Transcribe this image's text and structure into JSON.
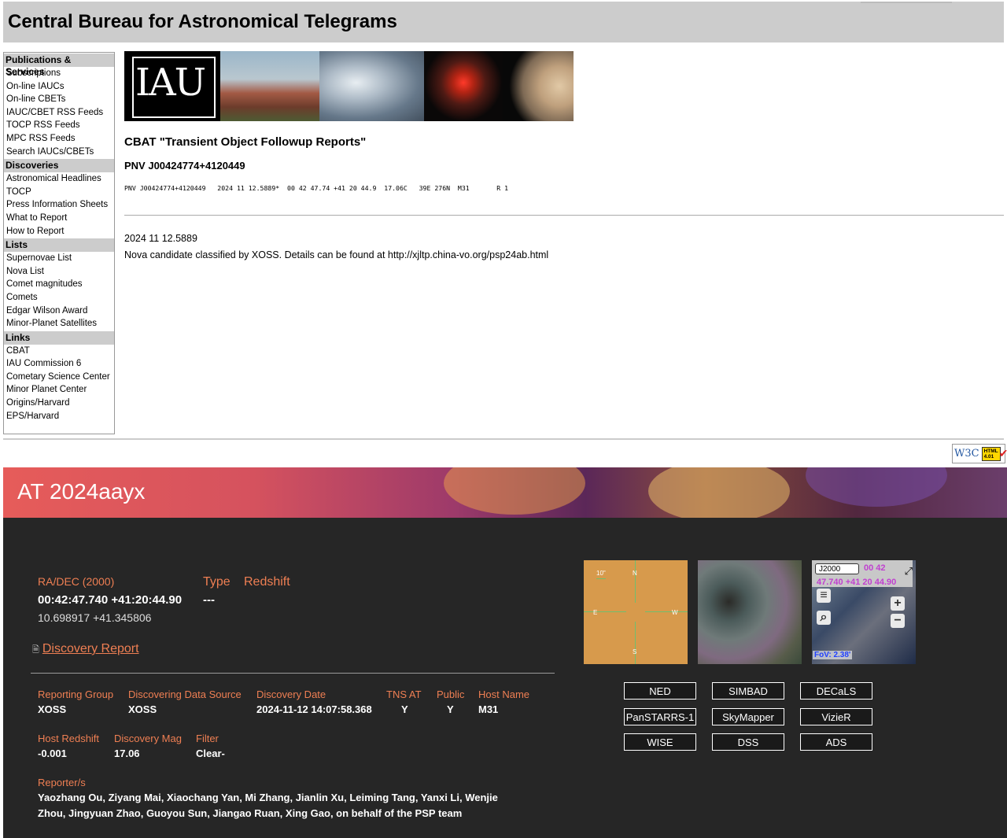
{
  "cbat": {
    "title": "Central Bureau for Astronomical Telegrams",
    "sidebar": [
      {
        "heading": "Publications & Services",
        "items": [
          "Subscriptions",
          "On-line IAUCs",
          "On-line CBETs",
          "IAUC/CBET RSS Feeds",
          "TOCP RSS Feeds",
          "MPC RSS Feeds",
          "Search IAUCs/CBETs"
        ]
      },
      {
        "heading": "Discoveries",
        "items": [
          "Astronomical Headlines",
          "TOCP",
          "Press Information Sheets",
          "What to Report",
          "How to Report"
        ]
      },
      {
        "heading": "Lists",
        "items": [
          "Supernovae List",
          "Nova List",
          "Comet magnitudes",
          "Comets",
          "Edgar Wilson Award",
          "Minor-Planet Satellites"
        ]
      },
      {
        "heading": "Links",
        "items": [
          "CBAT",
          "IAU Commission 6",
          "Cometary Science Center",
          "Minor Planet Center",
          "Origins/Harvard",
          "EPS/Harvard"
        ]
      }
    ],
    "banner_logo": "IAU",
    "heading": "CBAT \"Transient Object Followup Reports\"",
    "object": "PNV J00424774+4120449",
    "report_line": "PNV J00424774+4120449   2024 11 12.5889*  00 42 47.74 +41 20 44.9  17.06C   39E 276N  M31       R 1",
    "date": "2024 11 12.5889",
    "note": "Nova candidate classified by XOSS. Details can be found at http://xjltp.china-vo.org/psp24ab.html",
    "w3c_badge": {
      "w3c": "W3C",
      "html": "HTML",
      "version": "4.01"
    }
  },
  "tns": {
    "title": "AT 2024aayx",
    "radec_label": "RA/DEC (2000)",
    "radec_value": "00:42:47.740 +41:20:44.90",
    "radec_deg": "10.698917 +41.345806",
    "type_label": "Type",
    "type_value": "---",
    "redshift_label": "Redshift",
    "discovery_report": "Discovery Report",
    "fields_row1": [
      {
        "label": "Reporting Group",
        "value": "XOSS"
      },
      {
        "label": "Discovering Data Source",
        "value": "XOSS"
      },
      {
        "label": "Discovery Date",
        "value": "2024-11-12 14:07:58.368"
      },
      {
        "label": "TNS AT",
        "value": "Y"
      },
      {
        "label": "Public",
        "value": "Y"
      },
      {
        "label": "Host Name",
        "value": "M31"
      }
    ],
    "fields_row2": [
      {
        "label": "Host Redshift",
        "value": "-0.001"
      },
      {
        "label": "Discovery Mag",
        "value": "17.06"
      },
      {
        "label": "Filter",
        "value": "Clear-"
      }
    ],
    "reporters_label": "Reporter/s",
    "reporters": "Yaozhang Ou, Ziyang Mai, Xiaochang Yan, Mi Zhang, Jianlin Xu, Leiming Tang, Yanxi Li, Wenjie Zhou, Jingyuan Zhao, Guoyou Sun, Jiangao Ruan, Xing Gao, on behalf of the PSP team",
    "finder": {
      "scale": "10\"",
      "n": "N",
      "e": "E",
      "w": "W",
      "s": "S"
    },
    "aladin": {
      "frame": "J2000",
      "coord_a": "00 42",
      "coord_b": "47.740 +41 20 44.90",
      "fov": "FoV: 2.38'",
      "plus": "+",
      "minus": "−"
    },
    "links": [
      "NED",
      "SIMBAD",
      "DECaLS",
      "PanSTARRS-1",
      "SkyMapper",
      "VizieR",
      "WISE",
      "DSS",
      "ADS"
    ]
  }
}
